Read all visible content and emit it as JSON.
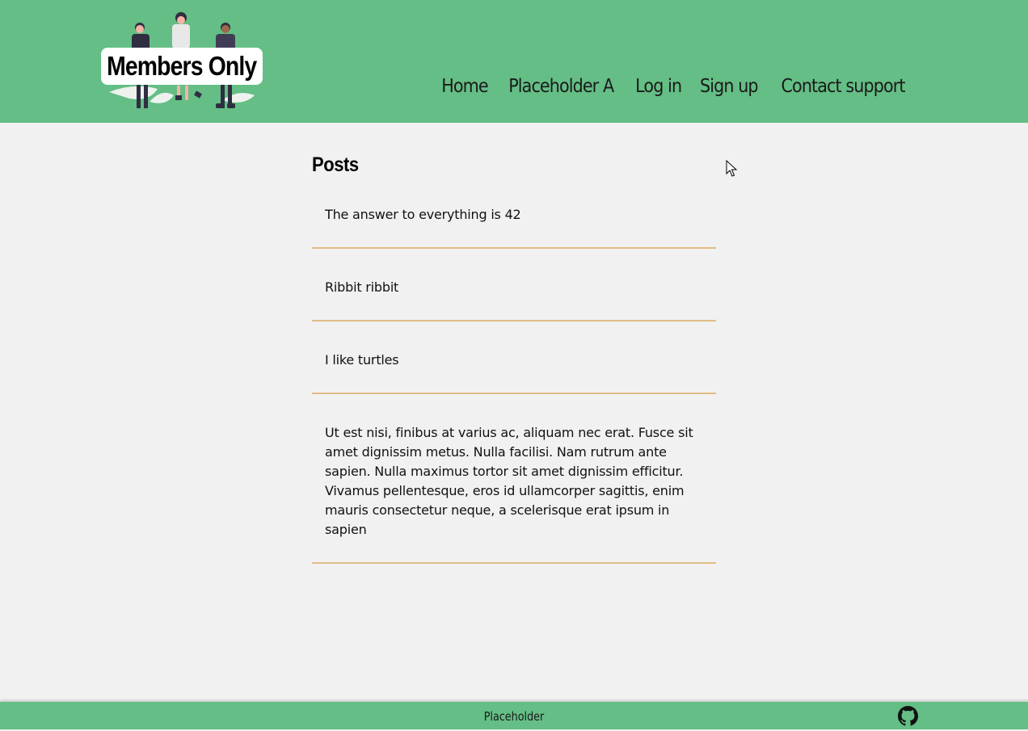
{
  "colors": {
    "accent": "#64be85",
    "background": "#f1f1f1",
    "post_divider": "#e2bd86"
  },
  "header": {
    "logo_text": "Members Only",
    "logo_illustration": "three-people-illustration",
    "nav": [
      {
        "label": "Home"
      },
      {
        "label": "Placeholder A"
      },
      {
        "label": "Log in"
      },
      {
        "label": "Sign up"
      },
      {
        "label": "Contact support"
      }
    ]
  },
  "main": {
    "title": "Posts",
    "posts": [
      {
        "text": "The answer to everything is 42"
      },
      {
        "text": "Ribbit ribbit"
      },
      {
        "text": "I like turtles"
      },
      {
        "text": "Ut est nisi, finibus at varius ac, aliquam nec erat. Fusce sit amet dignissim metus. Nulla facilisi. Nam rutrum ante sapien. Nulla maximus tortor sit amet dignissim efficitur. Vivamus pellentesque, eros id ullamcorper sagittis, enim mauris consectetur neque, a scelerisque erat ipsum in sapien"
      }
    ]
  },
  "footer": {
    "text": "Placeholder",
    "icon": "github-icon"
  }
}
